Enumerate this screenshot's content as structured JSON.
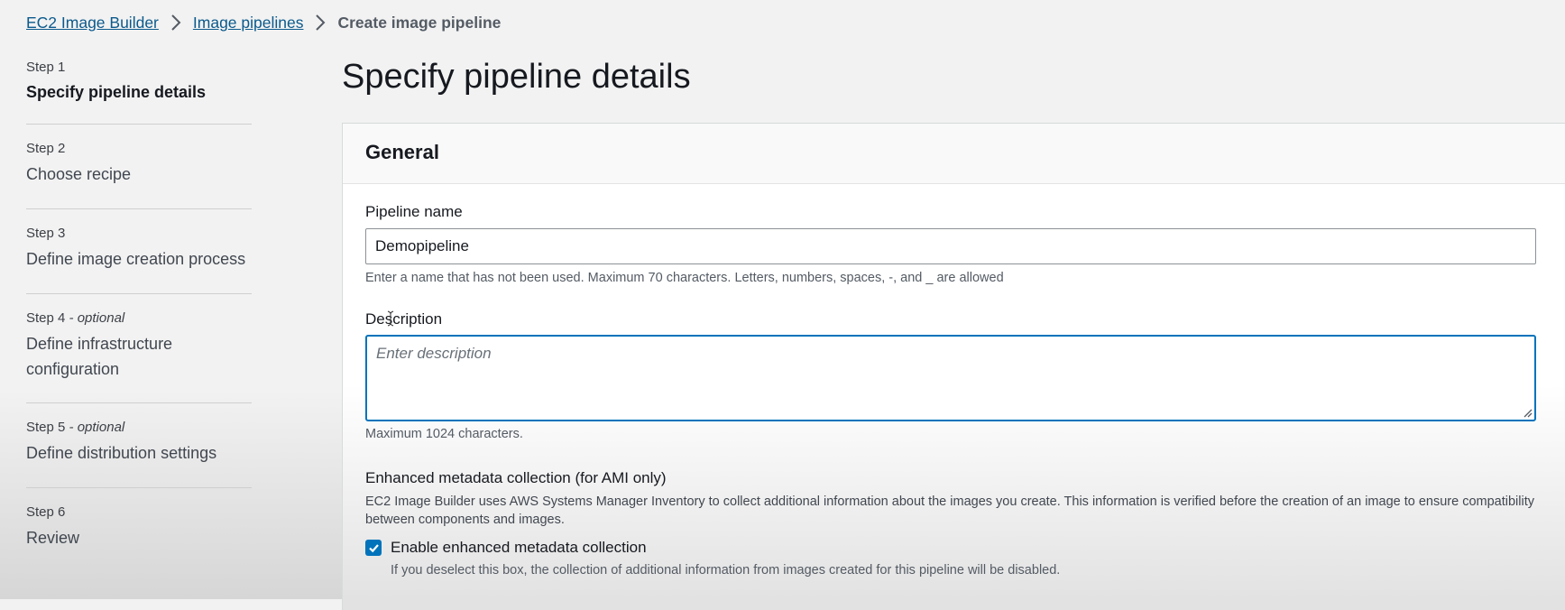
{
  "breadcrumb": {
    "items": [
      "EC2 Image Builder",
      "Image pipelines"
    ],
    "current": "Create image pipeline",
    "separator_icon": "chevron-right-icon"
  },
  "steps": [
    {
      "label": "Step 1",
      "optional": "",
      "title": "Specify pipeline details",
      "active": true
    },
    {
      "label": "Step 2",
      "optional": "",
      "title": "Choose recipe",
      "active": false
    },
    {
      "label": "Step 3",
      "optional": "",
      "title": "Define image creation process",
      "active": false
    },
    {
      "label": "Step 4",
      "optional": "- optional",
      "title_lines": [
        "Define infrastructure",
        "configuration"
      ],
      "active": false
    },
    {
      "label": "Step 5",
      "optional": "- optional",
      "title": "Define distribution settings",
      "active": false
    },
    {
      "label": "Step 6",
      "optional": "",
      "title": "Review",
      "active": false
    }
  ],
  "page": {
    "title": "Specify pipeline details"
  },
  "general": {
    "title": "General",
    "pipeline_name": {
      "label": "Pipeline name",
      "value": "Demopipeline",
      "hint": "Enter a name that has not been used. Maximum 70 characters. Letters, numbers, spaces, -, and _ are allowed"
    },
    "description": {
      "label": "Description",
      "placeholder": "Enter description",
      "hint": "Maximum 1024 characters."
    },
    "metadata": {
      "label": "Enhanced metadata collection (for AMI only)",
      "description": "EC2 Image Builder uses AWS Systems Manager Inventory to collect additional information about the images you create. This information is verified before the creation of an image to ensure compatibility between components and images.",
      "checkbox_label": "Enable enhanced metadata collection",
      "checked": true,
      "checkbox_hint": "If you deselect this box, the collection of additional information from images created for this pipeline will be disabled."
    }
  },
  "colors": {
    "link": "#0b5a8c",
    "accent": "#0073bb",
    "background": "#f2f2f2"
  }
}
